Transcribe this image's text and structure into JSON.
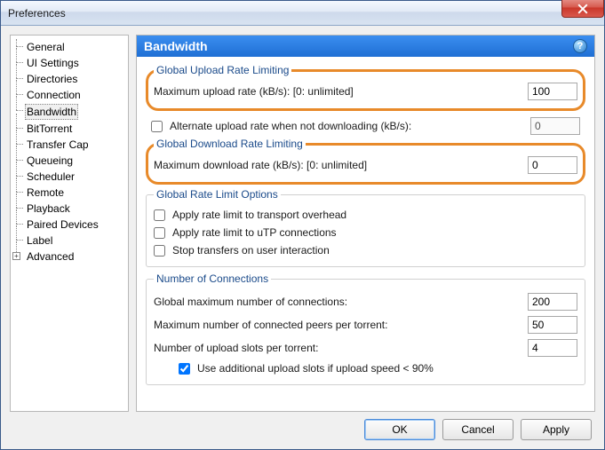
{
  "window": {
    "title": "Preferences"
  },
  "sidebar": {
    "items": [
      {
        "label": "General"
      },
      {
        "label": "UI Settings"
      },
      {
        "label": "Directories"
      },
      {
        "label": "Connection"
      },
      {
        "label": "Bandwidth",
        "selected": true
      },
      {
        "label": "BitTorrent"
      },
      {
        "label": "Transfer Cap"
      },
      {
        "label": "Queueing"
      },
      {
        "label": "Scheduler"
      },
      {
        "label": "Remote"
      },
      {
        "label": "Playback"
      },
      {
        "label": "Paired Devices"
      },
      {
        "label": "Label"
      },
      {
        "label": "Advanced",
        "expandable": true
      }
    ]
  },
  "panel": {
    "title": "Bandwidth",
    "help": "?",
    "upload": {
      "legend": "Global Upload Rate Limiting",
      "max_label": "Maximum upload rate (kB/s): [0: unlimited]",
      "max_value": "100"
    },
    "alt_upload": {
      "label": "Alternate upload rate when not downloading (kB/s):",
      "value": "0",
      "enabled": false
    },
    "download": {
      "legend": "Global Download Rate Limiting",
      "max_label": "Maximum download rate (kB/s): [0: unlimited]",
      "max_value": "0"
    },
    "options": {
      "legend": "Global Rate Limit Options",
      "overhead": "Apply rate limit to transport overhead",
      "utp": "Apply rate limit to uTP connections",
      "stop": "Stop transfers on user interaction"
    },
    "connections": {
      "legend": "Number of Connections",
      "global_label": "Global maximum number of connections:",
      "global_value": "200",
      "peers_label": "Maximum number of connected peers per torrent:",
      "peers_value": "50",
      "slots_label": "Number of upload slots per torrent:",
      "slots_value": "4",
      "extra_label": "Use additional upload slots if upload speed < 90%",
      "extra_checked": true
    }
  },
  "buttons": {
    "ok": "OK",
    "cancel": "Cancel",
    "apply": "Apply"
  }
}
